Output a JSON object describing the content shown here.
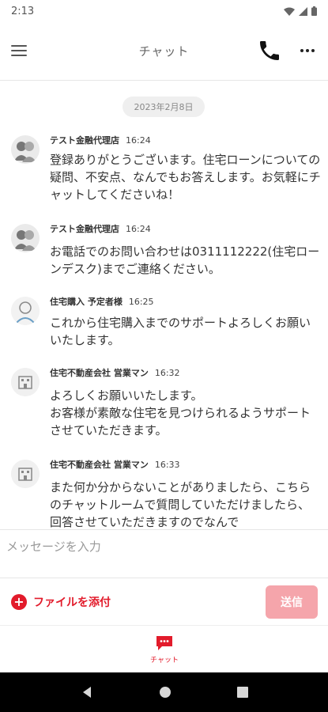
{
  "status_bar": {
    "time": "2:13"
  },
  "header": {
    "title": "チャット"
  },
  "chat": {
    "date": "2023年2月8日",
    "messages": [
      {
        "sender": "テスト金融代理店",
        "time": "16:24",
        "text": "登録ありがとうございます。住宅ローンについての疑問、不安点、なんでもお答えします。お気軽にチャットしてくださいね！"
      },
      {
        "sender": "テスト金融代理店",
        "time": "16:24",
        "text": "お電話でのお問い合わせは0311112222(住宅ローンデスク)までご連絡ください。"
      },
      {
        "sender": "住宅購入 予定者様",
        "time": "16:25",
        "text": "これから住宅購入までのサポートよろしくお願いいたします。"
      },
      {
        "sender": "住宅不動産会社 営業マン",
        "time": "16:32",
        "text": "よろしくお願いいたします。\nお客様が素敵な住宅を見つけられるようサポートさせていただきます。"
      },
      {
        "sender": "住宅不動産会社 営業マン",
        "time": "16:33",
        "text": "また何か分からないことがありましたら、こちらのチャットルームで質問していただけましたら、回答させていただきますのでなんで"
      }
    ]
  },
  "composer": {
    "placeholder": "メッセージを入力"
  },
  "actions": {
    "attach_label": "ファイルを添付",
    "send_label": "送信"
  },
  "tabs": {
    "chat_label": "チャット"
  },
  "colors": {
    "accent": "#e21b2b",
    "send_disabled": "#f5a5ab",
    "nav_bar": "#000000"
  }
}
